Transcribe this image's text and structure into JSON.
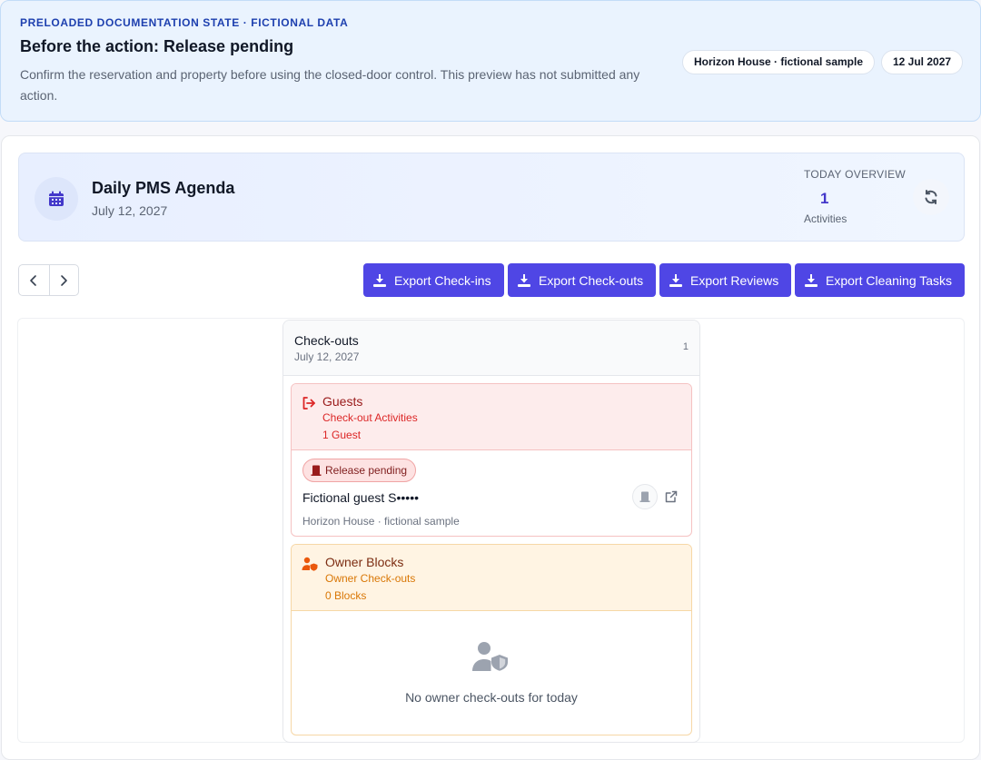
{
  "banner": {
    "eyebrow": "PRELOADED DOCUMENTATION STATE · FICTIONAL DATA",
    "title": "Before the action: Release pending",
    "description": "Confirm the reservation and property before using the closed-door control. This preview has not submitted any action.",
    "property_pill": "Horizon House · fictional sample",
    "date_pill": "12 Jul 2027"
  },
  "agenda": {
    "title": "Daily PMS Agenda",
    "date": "July 12, 2027",
    "icon": "calendar-icon",
    "overview_label": "TODAY OVERVIEW",
    "overview_count": "1",
    "overview_sub": "Activities"
  },
  "toolbar": {
    "exports": [
      {
        "label": "Export Check-ins"
      },
      {
        "label": "Export Check-outs"
      },
      {
        "label": "Export Reviews"
      },
      {
        "label": "Export Cleaning Tasks"
      }
    ]
  },
  "column": {
    "title": "Check-outs",
    "date": "July 12, 2027",
    "count": "1",
    "guests": {
      "title": "Guests",
      "subtitle": "Check-out Activities",
      "count": "1 Guest",
      "item": {
        "status": "Release pending",
        "name": "Fictional guest S•••••",
        "property": "Horizon House · fictional sample"
      }
    },
    "owner_blocks": {
      "title": "Owner Blocks",
      "subtitle": "Owner Check-outs",
      "count": "0 Blocks",
      "empty_text": "No owner check-outs for today"
    }
  },
  "colors": {
    "accent": "#4f46e5",
    "danger": "#dc2626",
    "warning": "#d97706",
    "banner_bg": "#eaf3fe"
  }
}
